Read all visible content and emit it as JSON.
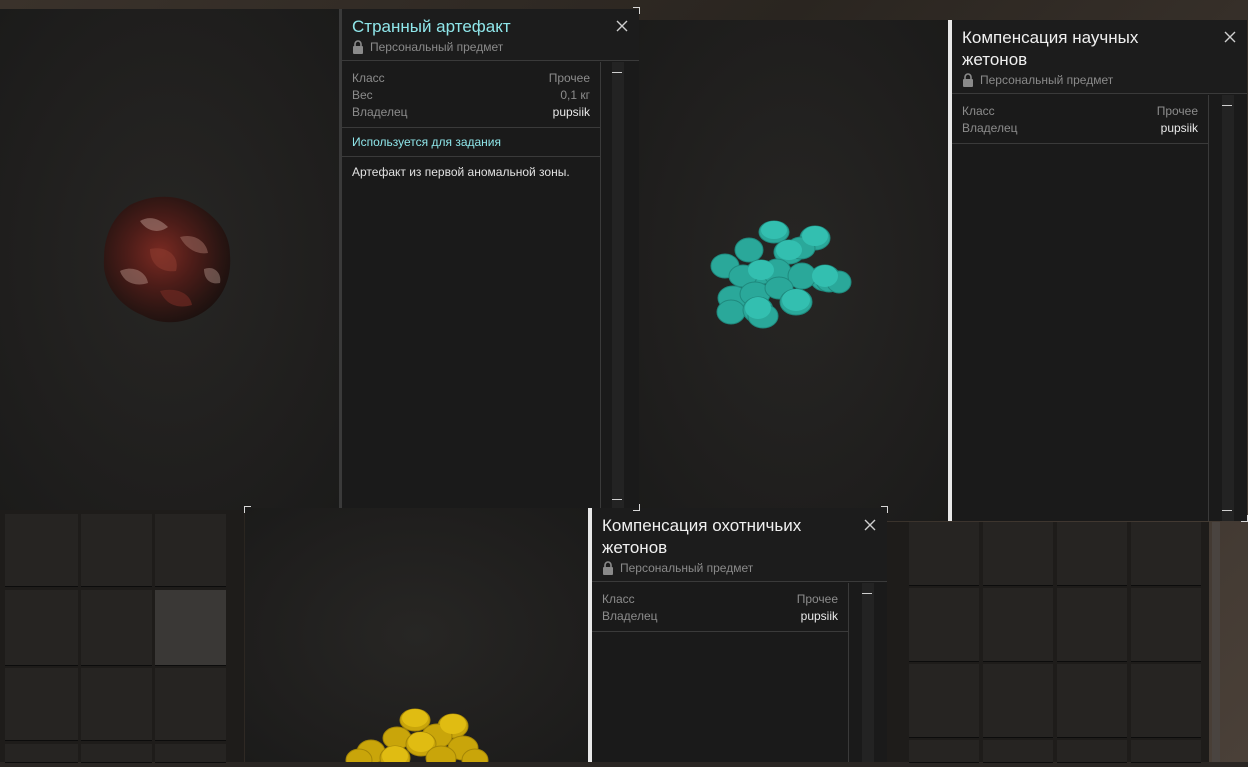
{
  "colors": {
    "accent_cyan": "#8fe6ea",
    "title_white": "#f0f0f0",
    "panel_bg": "#1a1a1a"
  },
  "card1": {
    "title": "Странный артефакт",
    "subtitle": "Персональный предмет",
    "rows": [
      {
        "key": "Класс",
        "value": "Прочее"
      },
      {
        "key": "Вес",
        "value": "0,1 кг"
      },
      {
        "key": "Владелец",
        "value": "pupsiik"
      }
    ],
    "quest_label": "Используется для задания",
    "description": "Артефакт из первой аномальной зоны.",
    "icon": "close-icon"
  },
  "card2": {
    "title": "Компенсация научных жетонов",
    "subtitle": "Персональный предмет",
    "rows": [
      {
        "key": "Класс",
        "value": "Прочее"
      },
      {
        "key": "Владелец",
        "value": "pupsiik"
      }
    ]
  },
  "card3": {
    "title": "Компенсация охотничьих жетонов",
    "subtitle": "Персональный предмет",
    "rows": [
      {
        "key": "Класс",
        "value": "Прочее"
      },
      {
        "key": "Владелец",
        "value": "pupsiik"
      }
    ]
  }
}
